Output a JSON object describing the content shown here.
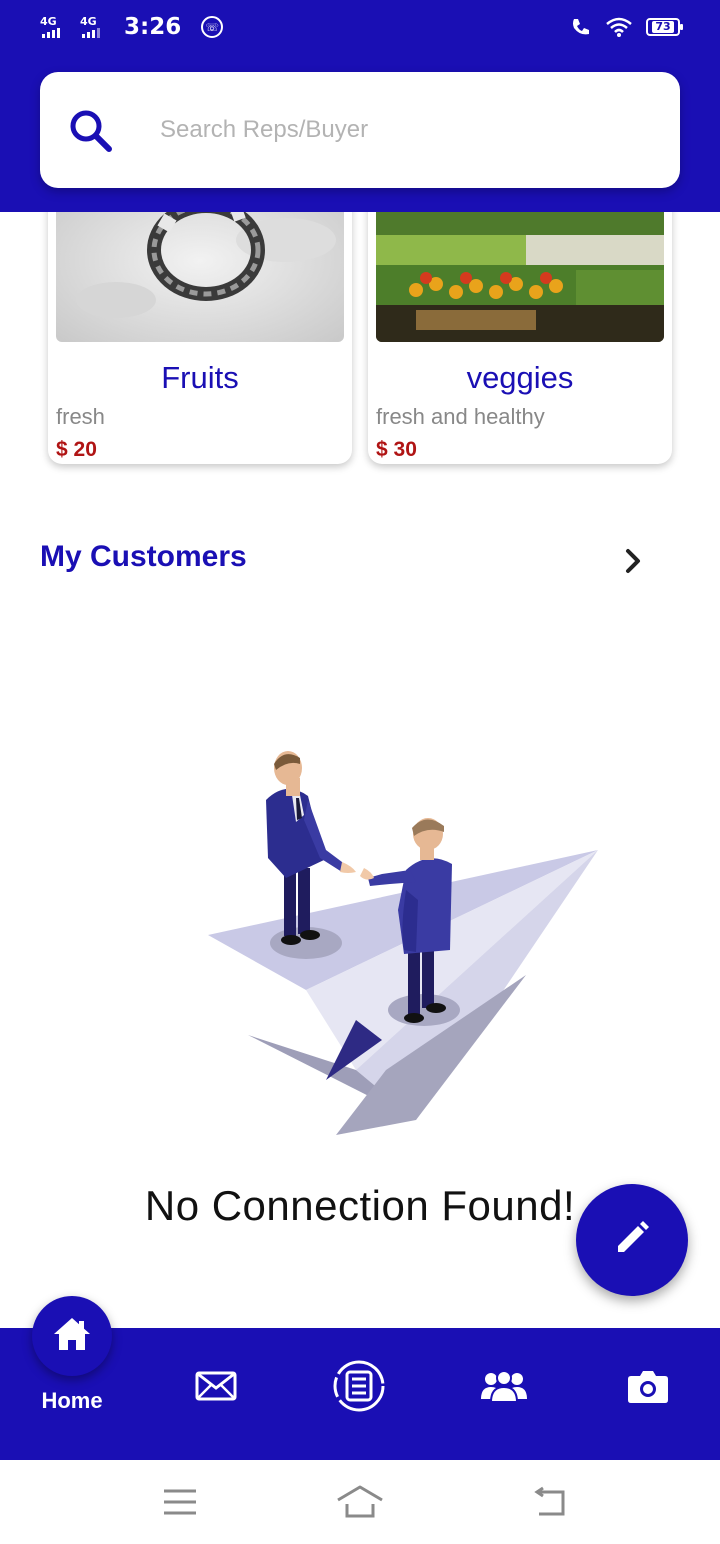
{
  "status_bar": {
    "network_1": "4G",
    "network_2": "4G",
    "time": "3:26",
    "battery_level": "73"
  },
  "search": {
    "placeholder": "Search Reps/Buyer"
  },
  "products": [
    {
      "title": "Fruits",
      "description": "fresh",
      "price": "$ 20"
    },
    {
      "title": "veggies",
      "description": "fresh and healthy",
      "price": "$ 30"
    }
  ],
  "customers_section": {
    "title": "My Customers"
  },
  "empty_state": {
    "message": "No Connection Found!"
  },
  "bottom_nav": {
    "home_label": "Home",
    "items": [
      "home-icon",
      "mail-icon",
      "list-icon",
      "people-icon",
      "camera-icon"
    ]
  },
  "colors": {
    "primary": "#1a0fb4",
    "price": "#b01414",
    "muted_text": "#888888"
  }
}
